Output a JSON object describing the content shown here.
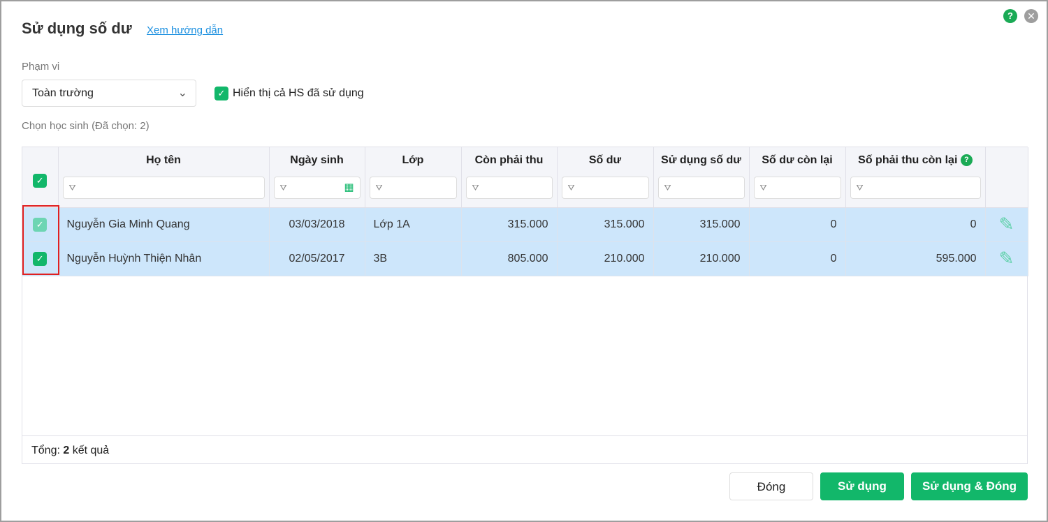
{
  "dialog": {
    "title": "Sử dụng số dư",
    "guide_link": "Xem hướng dẫn",
    "help": "?",
    "close": "✕"
  },
  "scope": {
    "label": "Phạm vi",
    "value": "Toàn trường"
  },
  "show_used": {
    "label": "Hiển thị cả HS đã sử dụng",
    "checked": true
  },
  "select_label": "Chọn học sinh (Đã chọn: 2)",
  "table": {
    "headers": [
      "Họ tên",
      "Ngày sinh",
      "Lớp",
      "Còn phải thu",
      "Số dư",
      "Sử dụng số dư",
      "Số dư còn lại",
      "Số phải thu còn lại"
    ],
    "rows": [
      {
        "name": "Nguyễn Gia Minh Quang",
        "dob": "03/03/2018",
        "class": "Lớp 1A",
        "due": "315.000",
        "balance": "315.000",
        "use": "315.000",
        "bal_left": "0",
        "due_left": "0"
      },
      {
        "name": "Nguyễn Huỳnh Thiện Nhân",
        "dob": "02/05/2017",
        "class": "3B",
        "due": "805.000",
        "balance": "210.000",
        "use": "210.000",
        "bal_left": "0",
        "due_left": "595.000"
      }
    ]
  },
  "footer": {
    "prefix": "Tổng: ",
    "count": "2",
    "suffix": " kết quả"
  },
  "buttons": {
    "close": "Đóng",
    "use": "Sử dụng",
    "use_close": "Sử dụng & Đóng"
  }
}
